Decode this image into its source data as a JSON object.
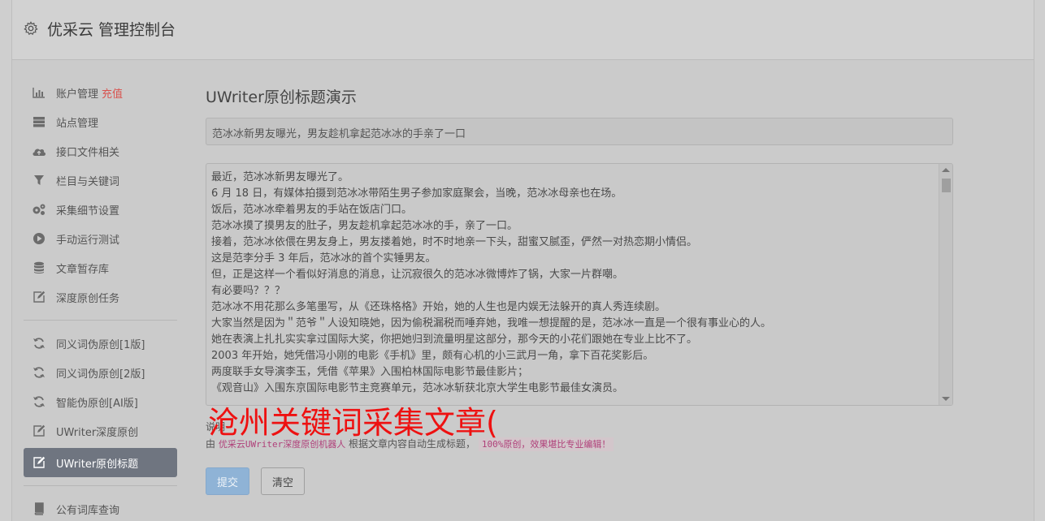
{
  "header": {
    "title": "优采云 管理控制台",
    "icon": "gear-icon"
  },
  "sidebar": {
    "group1": [
      {
        "label": "账户管理",
        "badge": "充值",
        "icon": "bar-chart-icon"
      },
      {
        "label": "站点管理",
        "icon": "server-icon"
      },
      {
        "label": "接口文件相关",
        "icon": "cloud-upload-icon"
      },
      {
        "label": "栏目与关键词",
        "icon": "filter-icon"
      },
      {
        "label": "采集细节设置",
        "icon": "cogs-icon"
      },
      {
        "label": "手动运行测试",
        "icon": "play-circle-icon"
      },
      {
        "label": "文章暂存库",
        "icon": "database-icon"
      },
      {
        "label": "深度原创任务",
        "icon": "edit-icon"
      }
    ],
    "group2": [
      {
        "label": "同义词伪原创[1版]",
        "icon": "refresh-icon"
      },
      {
        "label": "同义词伪原创[2版]",
        "icon": "refresh-icon"
      },
      {
        "label": "智能伪原创[AI版]",
        "icon": "refresh-icon"
      },
      {
        "label": "UWriter深度原创",
        "icon": "edit-icon"
      },
      {
        "label": "UWriter原创标题",
        "icon": "edit-icon",
        "active": true
      }
    ],
    "group3": [
      {
        "label": "公有词库查询",
        "icon": "book-icon"
      }
    ]
  },
  "main": {
    "title": "UWriter原创标题演示",
    "title_input_value": "范冰冰新男友曝光，男友趁机拿起范冰冰的手亲了一口",
    "article_lines": [
      "最近，范冰冰新男友曝光了。",
      "6 月 18 日，有媒体拍摄到范冰冰带陌生男子参加家庭聚会，当晚，范冰冰母亲也在场。",
      "饭后，范冰冰牵着男友的手站在饭店门口。",
      "范冰冰摸了摸男友的肚子，男友趁机拿起范冰冰的手，亲了一口。",
      "接着，范冰冰依偎在男友身上，男友搂着她，时不时地亲一下头，甜蜜又腻歪，俨然一对热恋期小情侣。",
      "这是范李分手 3 年后，范冰冰的首个实锤男友。",
      "但，正是这样一个看似好消息的消息，让沉寂很久的范冰冰微博炸了锅，大家一片群嘲。",
      "有必要吗？？？",
      "范冰冰不用花那么多笔墨写，从《还珠格格》开始，她的人生也是内娱无法躲开的真人秀连续剧。",
      "大家当然是因为＂范爷＂人设知晓她，因为偷税漏税而唾弃她，我唯一想提醒的是，范冰冰一直是一个很有事业心的人。",
      "她在表演上扎扎实实拿过国际大奖，你把她归到流量明星这部分，那今天的小花们跟她在专业上比不了。",
      "2003 年开始，她凭借冯小刚的电影《手机》里，颇有心机的小三武月一角，拿下百花奖影后。",
      "两度联手女导演李玉，凭借《苹果》入围柏林国际电影节最佳影片；",
      "《观音山》入围东京国际电影节主竞赛单元，范冰冰斩获北京大学生电影节最佳女演员。"
    ],
    "desc_label": "说明",
    "desc_prefix": "由",
    "desc_code": "优采云UWriter深度原创机器人",
    "desc_middle": "根据文章内容自动生成标题，",
    "desc_code2": "100%原创，效果堪比专业编辑！",
    "watermark": "沧州关键词采集文章(",
    "submit_label": "提交",
    "clear_label": "清空"
  },
  "colors": {
    "active_nav": "#6f7580",
    "primary_button": "#8fb3d6",
    "badge": "#d9534f",
    "watermark": "#ee1111"
  }
}
